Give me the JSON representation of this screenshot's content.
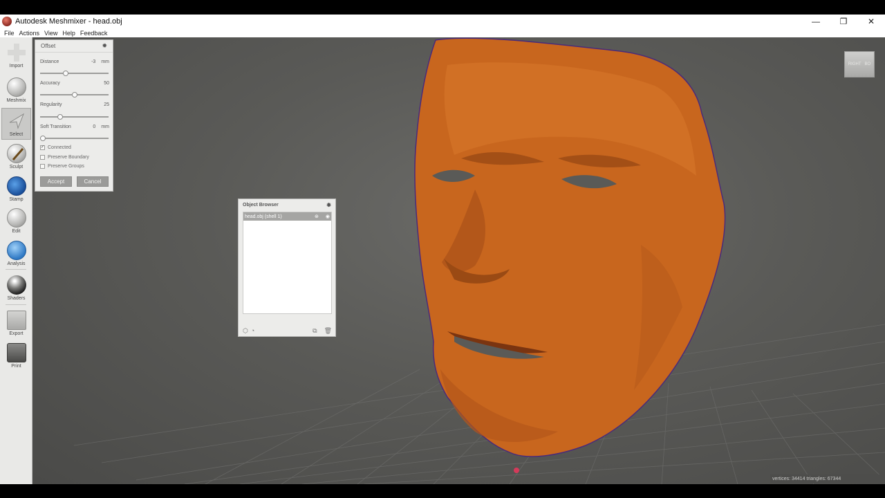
{
  "window": {
    "title": "Autodesk Meshmixer - head.obj",
    "minimize": "—",
    "restore": "❐",
    "close": "✕"
  },
  "menu": [
    "File",
    "Actions",
    "View",
    "Help",
    "Feedback"
  ],
  "toolbar": {
    "tools": [
      {
        "label": "Import",
        "icon": "plus-icon"
      },
      {
        "label": "Meshmix",
        "icon": "meshmix-sphere-icon"
      },
      {
        "label": "Select",
        "icon": "select-arrow-icon"
      },
      {
        "label": "Sculpt",
        "icon": "sculpt-brush-icon"
      },
      {
        "label": "Stamp",
        "icon": "stamp-icon"
      },
      {
        "label": "Edit",
        "icon": "edit-sphere-icon"
      },
      {
        "label": "Analysis",
        "icon": "analysis-mesh-icon"
      },
      {
        "label": "Shaders",
        "icon": "shader-ball-icon"
      },
      {
        "label": "Export",
        "icon": "export-icon"
      },
      {
        "label": "Print",
        "icon": "printer-icon"
      }
    ],
    "active_tool": "Select"
  },
  "offset_panel": {
    "title": "Offset",
    "distance": {
      "label": "Distance",
      "value": "-3",
      "unit": "mm",
      "level": 0.36
    },
    "accuracy": {
      "label": "Accuracy",
      "value": "50",
      "level": 0.5
    },
    "regularity": {
      "label": "Regularity",
      "value": "25",
      "level": 0.27
    },
    "soft_transition": {
      "label": "Soft Transition",
      "value": "0",
      "unit": "mm",
      "level": 0.0
    },
    "checkboxes": [
      {
        "label": "Connected",
        "checked": true
      },
      {
        "label": "Preserve Boundary",
        "checked": false
      },
      {
        "label": "Preserve Groups",
        "checked": false
      }
    ],
    "accept_label": "Accept",
    "cancel_label": "Cancel"
  },
  "object_browser": {
    "title": "Object Browser",
    "items": [
      {
        "name": "head.obj (shell 1)",
        "selected": true
      }
    ]
  },
  "viewcube": {
    "left_face": "RIGHT",
    "right_face": "BO"
  },
  "status": {
    "text": "vertices: 34414 triangles: 67344"
  },
  "colors": {
    "mesh": "#c8661e",
    "mesh_edge": "#4a2a7a",
    "viewport": "#5a5a57",
    "panel": "#ececea"
  }
}
